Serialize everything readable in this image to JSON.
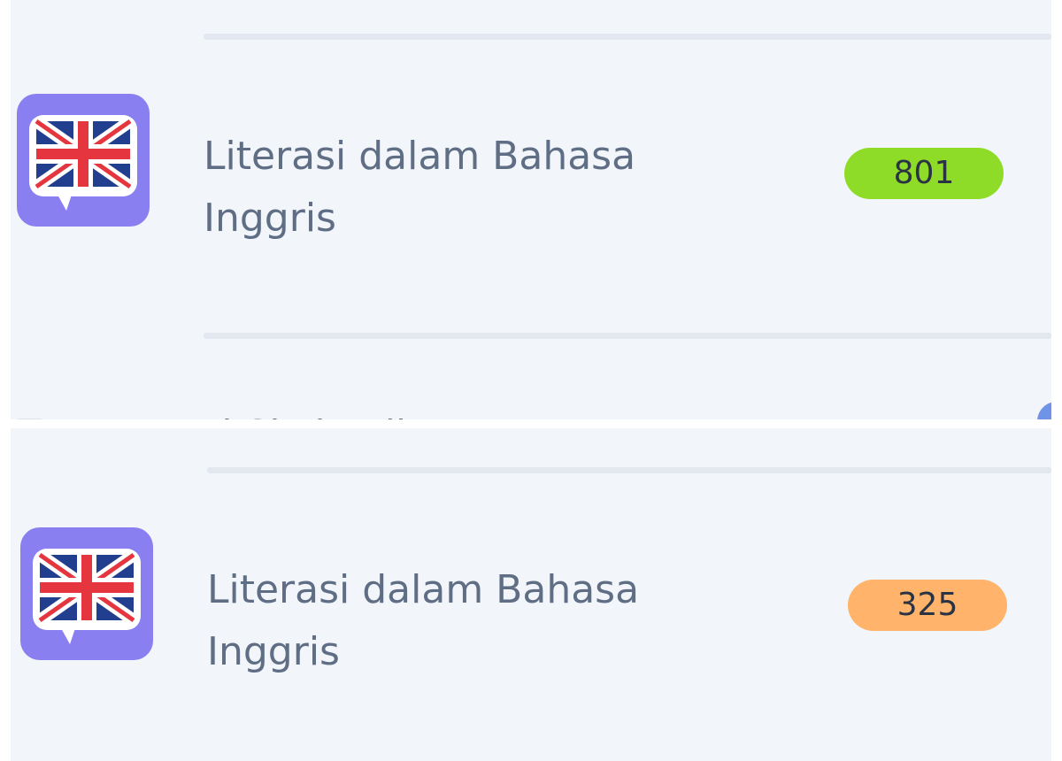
{
  "colors": {
    "panel_bg": "#f2f5fa",
    "icon_bg": "#8a7ff0",
    "badge_high": "#8edc28",
    "badge_low": "#ffb36b",
    "text": "#5f6e84"
  },
  "items": [
    {
      "title": "Literasi dalam Bahasa Inggris",
      "score": "801",
      "icon": "uk-flag-speech-bubble-icon"
    },
    {
      "title": "Literasi dalam Bahasa Inggris",
      "score": "325",
      "icon": "uk-flag-speech-bubble-icon"
    }
  ],
  "partial_next_item": {
    "title": "Tes Potensi Skolastik"
  }
}
